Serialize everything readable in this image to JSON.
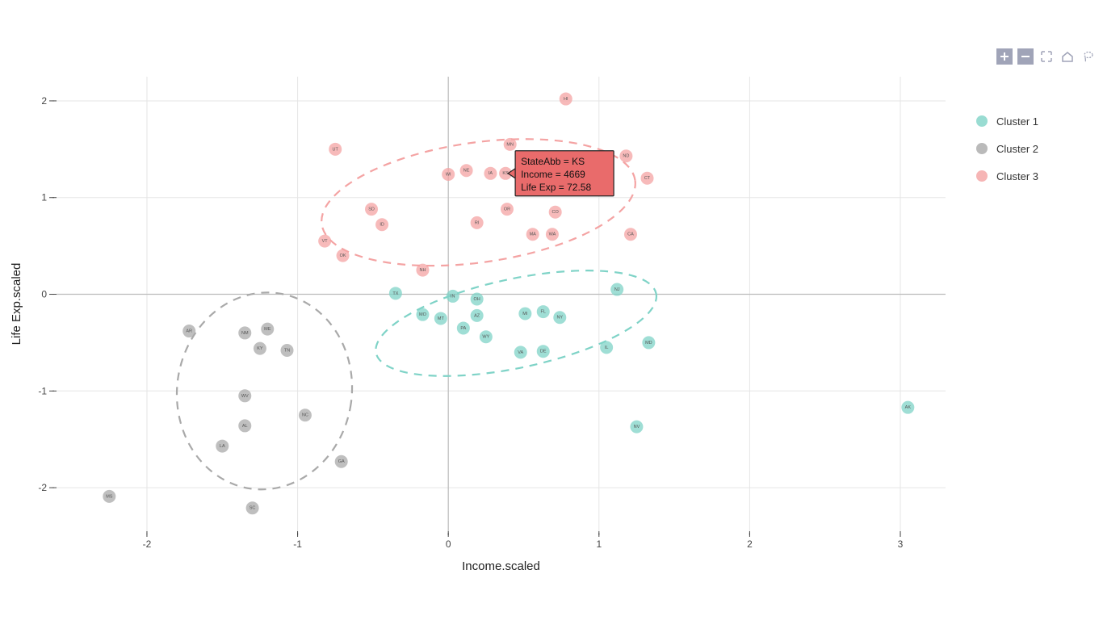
{
  "chart_data": {
    "type": "scatter",
    "title": "",
    "xlabel": "Income.scaled",
    "ylabel": "Life Exp.scaled",
    "xlim": [
      -2.6,
      3.3
    ],
    "ylim": [
      -2.45,
      2.25
    ],
    "xticks": [
      -2,
      -1,
      0,
      1,
      2,
      3
    ],
    "yticks": [
      -2,
      -1,
      0,
      1,
      2
    ],
    "grid": true,
    "legend_position": "right",
    "colors": {
      "Cluster 1": "#7fd3c7",
      "Cluster 2": "#a9a9a9",
      "Cluster 3": "#f4a3a3"
    },
    "series": [
      {
        "name": "Cluster 1",
        "points": [
          {
            "abb": "TX",
            "x": -0.35,
            "y": 0.01
          },
          {
            "abb": "MO",
            "x": -0.17,
            "y": -0.21
          },
          {
            "abb": "IN",
            "x": 0.03,
            "y": -0.02
          },
          {
            "abb": "MT",
            "x": -0.05,
            "y": -0.25
          },
          {
            "abb": "OH",
            "x": 0.19,
            "y": -0.05
          },
          {
            "abb": "AZ",
            "x": 0.19,
            "y": -0.22
          },
          {
            "abb": "PA",
            "x": 0.1,
            "y": -0.35
          },
          {
            "abb": "WY",
            "x": 0.25,
            "y": -0.44
          },
          {
            "abb": "MI",
            "x": 0.51,
            "y": -0.2
          },
          {
            "abb": "FL",
            "x": 0.63,
            "y": -0.18
          },
          {
            "abb": "NY",
            "x": 0.74,
            "y": -0.24
          },
          {
            "abb": "VA",
            "x": 0.48,
            "y": -0.6
          },
          {
            "abb": "DE",
            "x": 0.63,
            "y": -0.59
          },
          {
            "abb": "IL",
            "x": 1.05,
            "y": -0.55
          },
          {
            "abb": "NJ",
            "x": 1.12,
            "y": 0.05
          },
          {
            "abb": "MD",
            "x": 1.33,
            "y": -0.5
          },
          {
            "abb": "NV",
            "x": 1.25,
            "y": -1.37
          },
          {
            "abb": "AK",
            "x": 3.05,
            "y": -1.17
          }
        ]
      },
      {
        "name": "Cluster 2",
        "points": [
          {
            "abb": "MS",
            "x": -2.25,
            "y": -2.09
          },
          {
            "abb": "AR",
            "x": -1.72,
            "y": -0.38
          },
          {
            "abb": "NM",
            "x": -1.35,
            "y": -0.4
          },
          {
            "abb": "ME",
            "x": -1.2,
            "y": -0.36
          },
          {
            "abb": "KY",
            "x": -1.25,
            "y": -0.56
          },
          {
            "abb": "TN",
            "x": -1.07,
            "y": -0.58
          },
          {
            "abb": "WV",
            "x": -1.35,
            "y": -1.05
          },
          {
            "abb": "NC",
            "x": -0.95,
            "y": -1.25
          },
          {
            "abb": "AL",
            "x": -1.35,
            "y": -1.36
          },
          {
            "abb": "LA",
            "x": -1.5,
            "y": -1.57
          },
          {
            "abb": "GA",
            "x": -0.71,
            "y": -1.73
          },
          {
            "abb": "SC",
            "x": -1.3,
            "y": -2.21
          }
        ]
      },
      {
        "name": "Cluster 3",
        "points": [
          {
            "abb": "UT",
            "x": -0.75,
            "y": 1.5
          },
          {
            "abb": "SD",
            "x": -0.51,
            "y": 0.88
          },
          {
            "abb": "ID",
            "x": -0.44,
            "y": 0.72
          },
          {
            "abb": "VT",
            "x": -0.82,
            "y": 0.55
          },
          {
            "abb": "OK",
            "x": -0.7,
            "y": 0.4
          },
          {
            "abb": "NH",
            "x": -0.17,
            "y": 0.25
          },
          {
            "abb": "WI",
            "x": 0.0,
            "y": 1.24
          },
          {
            "abb": "NE",
            "x": 0.12,
            "y": 1.28
          },
          {
            "abb": "IA",
            "x": 0.28,
            "y": 1.25
          },
          {
            "abb": "KS",
            "x": 0.38,
            "y": 1.25
          },
          {
            "abb": "MN",
            "x": 0.41,
            "y": 1.55
          },
          {
            "abb": "OR",
            "x": 0.39,
            "y": 0.88
          },
          {
            "abb": "RI",
            "x": 0.19,
            "y": 0.74
          },
          {
            "abb": "MA",
            "x": 0.56,
            "y": 0.62
          },
          {
            "abb": "CO",
            "x": 0.71,
            "y": 0.85
          },
          {
            "abb": "WA",
            "x": 0.69,
            "y": 0.62
          },
          {
            "abb": "HI",
            "x": 0.78,
            "y": 2.02
          },
          {
            "abb": "ND",
            "x": 1.18,
            "y": 1.43
          },
          {
            "abb": "CT",
            "x": 1.32,
            "y": 1.2
          },
          {
            "abb": "CA",
            "x": 1.21,
            "y": 0.62
          }
        ]
      }
    ],
    "ellipses": [
      {
        "cluster": "Cluster 1",
        "cx": 0.45,
        "cy": -0.3,
        "rx": 0.95,
        "ry": 0.46,
        "angle": -12
      },
      {
        "cluster": "Cluster 2",
        "cx": -1.22,
        "cy": -1.0,
        "rx": 0.58,
        "ry": 1.02,
        "angle": 8
      },
      {
        "cluster": "Cluster 3",
        "cx": 0.2,
        "cy": 0.95,
        "rx": 1.05,
        "ry": 0.62,
        "angle": -8
      }
    ],
    "tooltip": {
      "anchor_point": {
        "abb": "KS",
        "x": 0.38,
        "y": 1.25
      },
      "lines": [
        "StateAbb = KS",
        "Income = 4669",
        "Life Exp = 72.58"
      ]
    }
  },
  "legend": {
    "items": [
      "Cluster 1",
      "Cluster 2",
      "Cluster 3"
    ]
  },
  "toolbar": {
    "zoom_in": "+",
    "zoom_out": "−",
    "expand": "expand",
    "home": "home",
    "lasso": "lasso"
  }
}
